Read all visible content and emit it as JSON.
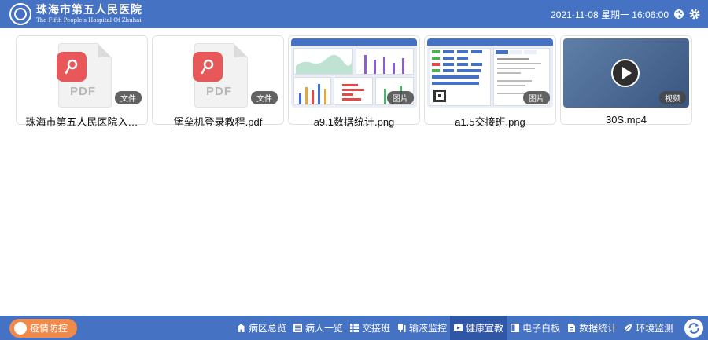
{
  "header": {
    "hospital_name_cn": "珠海市第五人民医院",
    "hospital_name_en": "The Fifth People's Hospital Of Zhuhai",
    "datetime": "2021-11-08 星期一 16:06:00",
    "icons": [
      "palette-icon",
      "gear-icon"
    ]
  },
  "files": [
    {
      "name": "珠海市第五人民医院入…",
      "badge": "文件",
      "kind": "pdf"
    },
    {
      "name": "堡垒机登录教程.pdf",
      "badge": "文件",
      "kind": "pdf"
    },
    {
      "name": "a9.1数据统计.png",
      "badge": "图片",
      "kind": "image-stats"
    },
    {
      "name": "a1.5交接班.png",
      "badge": "图片",
      "kind": "image-handover"
    },
    {
      "name": "30S.mp4",
      "badge": "视频",
      "kind": "video"
    }
  ],
  "pdf_label": "PDF",
  "footer": {
    "epidemic_button": "疫情防控",
    "nav": [
      {
        "label": "病区总览",
        "icon": "home-icon",
        "active": false
      },
      {
        "label": "病人一览",
        "icon": "list-icon",
        "active": false
      },
      {
        "label": "交接班",
        "icon": "grid-icon",
        "active": false
      },
      {
        "label": "输液监控",
        "icon": "infusion-icon",
        "active": false
      },
      {
        "label": "健康宣教",
        "icon": "video-icon",
        "active": true
      },
      {
        "label": "电子白板",
        "icon": "whiteboard-icon",
        "active": false
      },
      {
        "label": "数据统计",
        "icon": "document-icon",
        "active": false
      },
      {
        "label": "环境监测",
        "icon": "leaf-icon",
        "active": false
      }
    ]
  },
  "colors": {
    "primary": "#4672c4",
    "nav_active": "#2f57a6",
    "epidemic_button": "#f08a4b",
    "pdf_red": "#e8575a"
  }
}
